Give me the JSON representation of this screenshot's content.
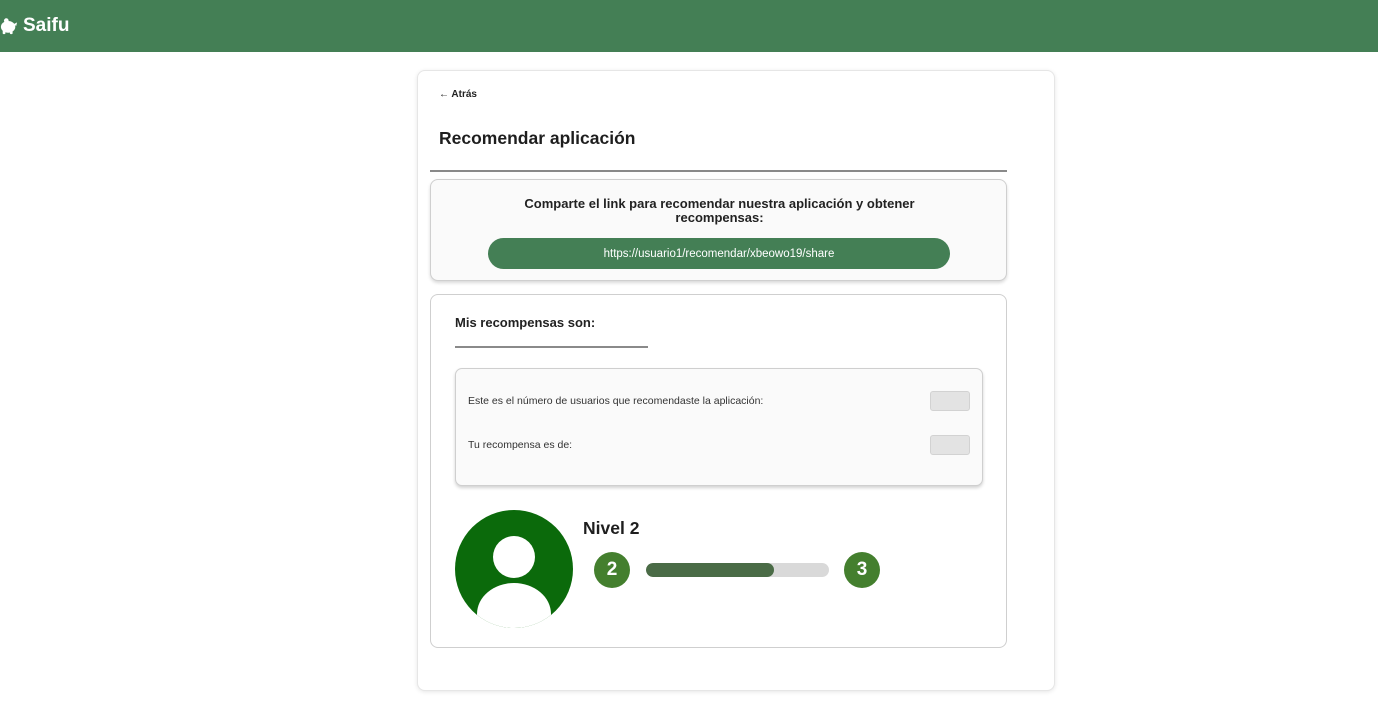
{
  "app": {
    "name": "Saifu"
  },
  "nav": {
    "back_label": "← Atrás"
  },
  "page": {
    "title": "Recomendar aplicación"
  },
  "share": {
    "text": "Comparte el link para recomendar nuestra aplicación y obtener recompensas:",
    "link": "https://usuario1/recomendar/xbeowo19/share"
  },
  "rewards": {
    "title": "Mis recompensas son:",
    "referred_label": "Este es el número de usuarios que recomendaste la aplicación:",
    "referred_value": "",
    "reward_label": "Tu recompensa es de:",
    "reward_value": ""
  },
  "level": {
    "title": "Nivel 2",
    "current": "2",
    "next": "3",
    "progress": 0.7
  },
  "colors": {
    "brand": "#447f55",
    "avatar": "#0b6a0b",
    "badge": "#447f2e",
    "progress_fill": "#4a6b46"
  }
}
